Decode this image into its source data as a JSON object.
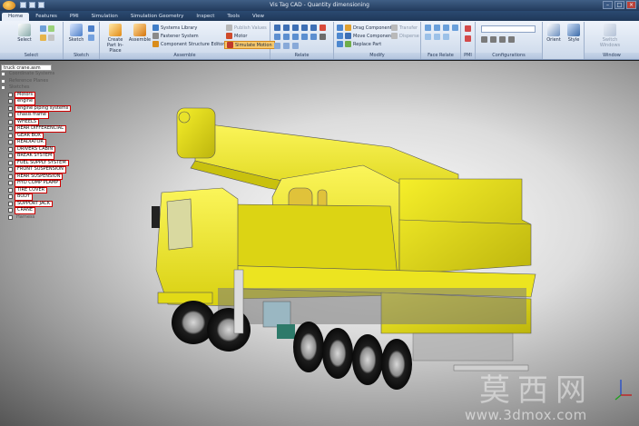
{
  "window": {
    "title": "Vis Tag CAD - Quantity dimensioning"
  },
  "tabs": [
    {
      "label": "Home",
      "active": true
    },
    {
      "label": "Features"
    },
    {
      "label": "PMI"
    },
    {
      "label": "Simulation"
    },
    {
      "label": "Simulation Geometry"
    },
    {
      "label": "Inspect"
    },
    {
      "label": "Tools"
    },
    {
      "label": "View"
    }
  ],
  "ribbon": {
    "groups": {
      "select": "Select",
      "sketch": "Sketch",
      "assemble": "Assemble",
      "relate": "Relate",
      "modify": "Modify",
      "face_relate": "Face Relate",
      "pmi": "PMI",
      "configurations": "Configurations",
      "window": "Window"
    },
    "buttons": {
      "select": "Select",
      "sketch": "Sketch",
      "create_part": "Create Part In-Place",
      "assemble": "Assemble",
      "systems_library": "Systems Library",
      "fastener_system": "Fastener System",
      "component_structure_editor": "Component Structure Editor",
      "publish_variables": "Publish Values",
      "motor": "Motor",
      "simulate_motion": "Simulate Motion",
      "drag_component": "Drag Component",
      "move_components": "Move Components",
      "replace_part": "Replace Part",
      "transfer": "Transfer",
      "disperse": "Disperse",
      "orient": "Orient",
      "style": "Style",
      "switch_windows": "Switch Windows"
    }
  },
  "tree": {
    "root": "truck crane.asm",
    "items": [
      {
        "label": "Coordinate Systems",
        "plain": true
      },
      {
        "label": "Reference Planes",
        "plain": true
      },
      {
        "label": "Sketches",
        "plain": true
      },
      {
        "label": "Motors"
      },
      {
        "label": "engine"
      },
      {
        "label": "engine piping systems"
      },
      {
        "label": "chasis frame"
      },
      {
        "label": "WHEELS"
      },
      {
        "label": "REAR DIFFERENCIAL"
      },
      {
        "label": "GEAR BOX"
      },
      {
        "label": "READIATOR"
      },
      {
        "label": "DRIVERS CABIN"
      },
      {
        "label": "BREAK SYSTEM"
      },
      {
        "label": "FUEL SUPPLY SYSTEM"
      },
      {
        "label": "FRONT SUSPENSION"
      },
      {
        "label": "REAR SUSPENSION"
      },
      {
        "label": "HYD COMP PLAMP"
      },
      {
        "label": "TIRE COVER"
      },
      {
        "label": "BODY"
      },
      {
        "label": "SUPPORT JACK"
      },
      {
        "label": "CRANE"
      },
      {
        "label": "Harness",
        "plain": true
      }
    ]
  },
  "watermark": {
    "cn": "莫西网",
    "url": "www.3dmox.com"
  },
  "colors": {
    "model_yellow": "#f2ec1c",
    "model_shadow": "#b8b012",
    "tree_border": "#cc0000",
    "ribbon_top": "#eef3fa"
  }
}
